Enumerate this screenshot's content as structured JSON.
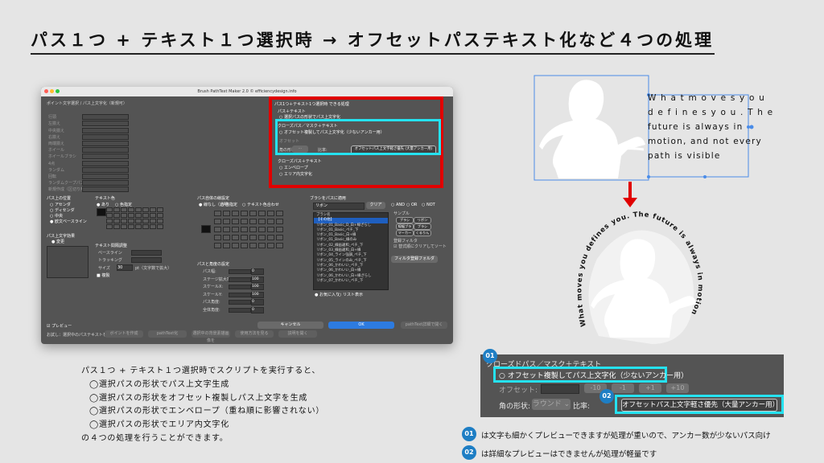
{
  "title": "パス１つ + テキスト１つ選択時 → オフセットパステキスト化など４つの処理",
  "dialog": {
    "window_title": "Brush PathText Maker 2.0 © efficiencydesign.info",
    "red_section_title": "パス1つ＋テキスト1つ選択時 できる処理",
    "path_text_heading": "パス＋テキスト",
    "path_text_option": "選択パスの形状でパス上文字化",
    "closed_path_heading": "クローズパス／マスク＋テキスト",
    "offset_option": "オフセット複製してパス上文字化（少ないアンカー用）",
    "offset_label": "オフセット",
    "corner_label": "角の形状:",
    "ratio_label": "比率:",
    "ratio_button": "オフセットパス上文字軽さ優先 (大量アンカー用)",
    "closed_text_heading": "クローズパス＋テキスト",
    "envelope_option": "エンベロープ",
    "area_text_option": "エリア内文字化",
    "left_col": [
      "ポイント文字選択 / パス上文字化（新規可）",
      "行頭",
      "左揃え",
      "中央揃え",
      "右揃え",
      "両端揃え",
      "ホイール",
      "ホイールブラシ",
      "4点",
      "ランダム",
      "回転",
      "ランダムクープパスを移動",
      "新規作成（区切り無し）"
    ],
    "path_pos_title": "パス上の位置",
    "path_pos_options": [
      "アセンダ",
      "ディセンダ",
      "中央",
      "欧文ベースライン"
    ],
    "path_effect_title": "パス上文字効果",
    "path_effect_value": "変更",
    "text_color_title": "テキスト色",
    "text_color_options": [
      "あり",
      "色指定"
    ],
    "text_spacing_title": "テキスト間隔調整",
    "baseline_label": "ベースライン",
    "tracking_label": "トラッキング",
    "size_label": "サイズ",
    "size_value": "30",
    "size_unit": "pt（文字数で拡大）",
    "embed_label": "複製",
    "body_line_title": "パス自体の線設定",
    "body_line_options": [
      "線なし（透明）",
      "色指定",
      "テキスト色合わせ"
    ],
    "angle_title": "パスと角度の設定",
    "angle_fields": [
      "パス幅:",
      "ステージ拡大率:",
      "スケールX:",
      "スケールY:",
      "パス角度:",
      "全体角度:"
    ],
    "angle_values": [
      "0",
      "100",
      "100",
      "100",
      "0",
      "0"
    ],
    "brush_title": "ブラシをパスに適用",
    "brush_select": "リボン",
    "clear_btn": "クリア",
    "and_or": [
      "AND",
      "OR",
      "NOT"
    ],
    "sample_label": "サンプル",
    "filter_label": "登録フィルタ",
    "filter_tags": [
      "ブラシ",
      "リボン",
      "線幅ブラシ",
      "ブラシ",
      "マーカー",
      "くるりん"
    ],
    "brush_list": [
      "ブラシ名",
      "【その他】",
      "リボン_01_Basic_D_白+線ざらし",
      "リボン_01_Basic_ペチ_下",
      "リボン_01_Basic_白+線",
      "リボン_01_Basic_線のみ",
      "リボン_02_線画違和_ペチ_下",
      "リボン_03_線画違和_白+線",
      "リボン_04_ライン強調_ペチ_下",
      "リボン_05_ラインのみ_ペチ_下",
      "リボン_06_かわいい_ペチ_下",
      "リボン_06_かわいい_白+線",
      "リボン_06_かわいい_白+線ざらし",
      "リボン_07_かわいい_ペチ_下"
    ],
    "favorite_label": "お気に入り",
    "list_display": "リスト表示",
    "sort_label": "替式順にクリアしてソート",
    "fixed_btn": "フィルタ登録フォルダ",
    "preview_label": "プレビュー",
    "footer_hint": "お試し：選択中のパステキストを、",
    "footer_btns": [
      "ボイントを作成",
      "pathText化",
      "選択中の背景素描画像を",
      "使用方法を見る",
      "説明を開く"
    ],
    "cancel_btn": "キャンセル",
    "ok_btn": "OK",
    "right_footer_btn": "pathText詳細で開く"
  },
  "illustration": {
    "caption_lines": [
      "W h a t   m o v e s   y o u",
      "d e f i n e s   y o u .   T h e",
      "future is always in",
      "motion, and not every",
      "path is visible"
    ],
    "arc_text": "What moves you defines you. The future is always in motion, and not every path is visible"
  },
  "zoom": {
    "heading": "クローズドパス／マスク＋テキスト",
    "offset_option": "オフセット複製してパス上文字化（少ないアンカー用）",
    "offset_label": "オフセット:",
    "steps": [
      "-10",
      "-1",
      "+1",
      "+10"
    ],
    "corner_label": "角の形状:",
    "corner_value": "ラウンド",
    "ratio_label": "比率:",
    "ratio_button": "オフセットパス上文字軽さ優先（大量アンカー用）",
    "badge1": "01",
    "badge2": "02"
  },
  "description": {
    "lines": [
      "パス１つ + テキスト１つ選択時でスクリプトを実行すると、",
      "◯選択パスの形状でパス上文字生成",
      "◯選択パスの形状をオフセット複製しパス上文字を生成",
      "◯選択パスの形状でエンベロープ（重ね順に影響されない）",
      "◯選択パスの形状でエリア内文字化",
      "の４つの処理を行うことができます。"
    ]
  },
  "notes": [
    {
      "badge": "01",
      "text": "は文字も細かくプレビューできますが処理が重いので、アンカー数が少ないパス向け"
    },
    {
      "badge": "02",
      "text": "は詳細なプレビューはできませんが処理が軽量です"
    }
  ],
  "colors": {
    "red": "#e00000",
    "cyan": "#25e2f0",
    "badge": "#1e7ec4",
    "dialog_bg": "#545454",
    "ok_blue": "#2d7be0"
  }
}
